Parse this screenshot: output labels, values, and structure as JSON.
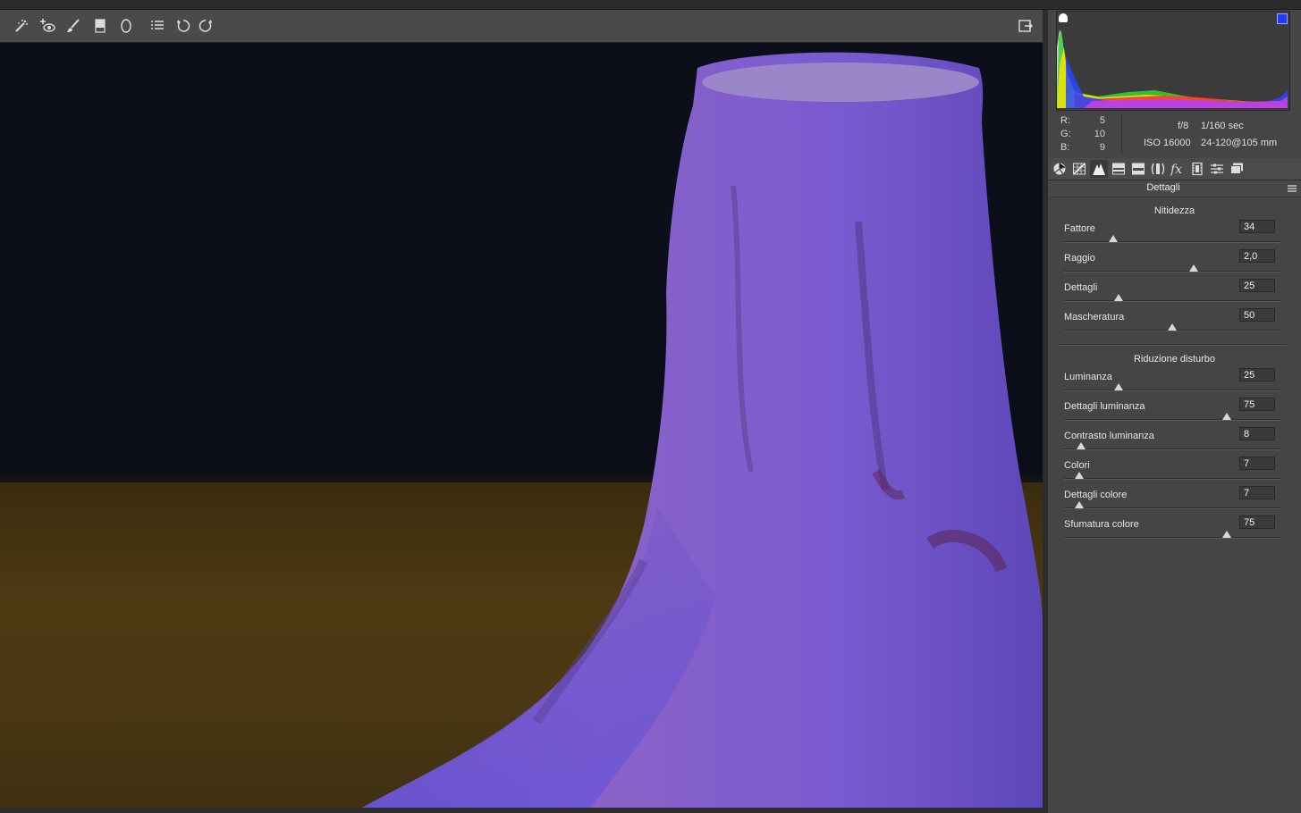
{
  "toolbar": {
    "tools": [
      {
        "name": "spot-removal-icon"
      },
      {
        "name": "red-eye-icon"
      },
      {
        "name": "adjustment-brush-icon"
      },
      {
        "name": "graduated-filter-icon"
      },
      {
        "name": "radial-filter-icon"
      },
      {
        "name": "presets-list-icon"
      },
      {
        "name": "rotate-ccw-icon"
      },
      {
        "name": "rotate-cw-icon"
      }
    ],
    "export_icon": "open-in-photoshop-icon"
  },
  "readout": {
    "r_label": "R:",
    "r_value": "5",
    "g_label": "G:",
    "g_value": "10",
    "b_label": "B:",
    "b_value": "9",
    "aperture": "f/8",
    "shutter": "1/160 sec",
    "iso": "ISO 16000",
    "lens": "24-120@105 mm"
  },
  "tabs": [
    {
      "name": "basic-tab-icon"
    },
    {
      "name": "tone-curve-tab-icon"
    },
    {
      "name": "detail-tab-icon",
      "active": true
    },
    {
      "name": "hsl-tab-icon"
    },
    {
      "name": "split-toning-tab-icon"
    },
    {
      "name": "lens-corrections-tab-icon"
    },
    {
      "name": "effects-tab-icon"
    },
    {
      "name": "camera-calibration-tab-icon"
    },
    {
      "name": "presets-tab-icon"
    },
    {
      "name": "snapshots-tab-icon"
    }
  ],
  "panel": {
    "title": "Dettagli",
    "sharpening": {
      "title": "Nitidezza",
      "controls": [
        {
          "label": "Fattore",
          "value": "34",
          "fraction": 0.227
        },
        {
          "label": "Raggio",
          "value": "2,0",
          "fraction": 0.6
        },
        {
          "label": "Dettagli",
          "value": "25",
          "fraction": 0.25
        },
        {
          "label": "Mascheratura",
          "value": "50",
          "fraction": 0.5
        }
      ]
    },
    "noise": {
      "title": "Riduzione disturbo",
      "controls": [
        {
          "label": "Luminanza",
          "value": "25",
          "fraction": 0.25
        },
        {
          "label": "Dettagli luminanza",
          "value": "75",
          "fraction": 0.75
        },
        {
          "label": "Contrasto luminanza",
          "value": "8",
          "fraction": 0.08
        },
        {
          "label": "Colori",
          "value": "7",
          "fraction": 0.07
        },
        {
          "label": "Dettagli colore",
          "value": "7",
          "fraction": 0.07
        },
        {
          "label": "Sfumatura colore",
          "value": "75",
          "fraction": 0.75
        }
      ]
    }
  },
  "colors": {
    "clip_highlight": "#1e3cff",
    "clip_shadow": "#ffffff"
  }
}
